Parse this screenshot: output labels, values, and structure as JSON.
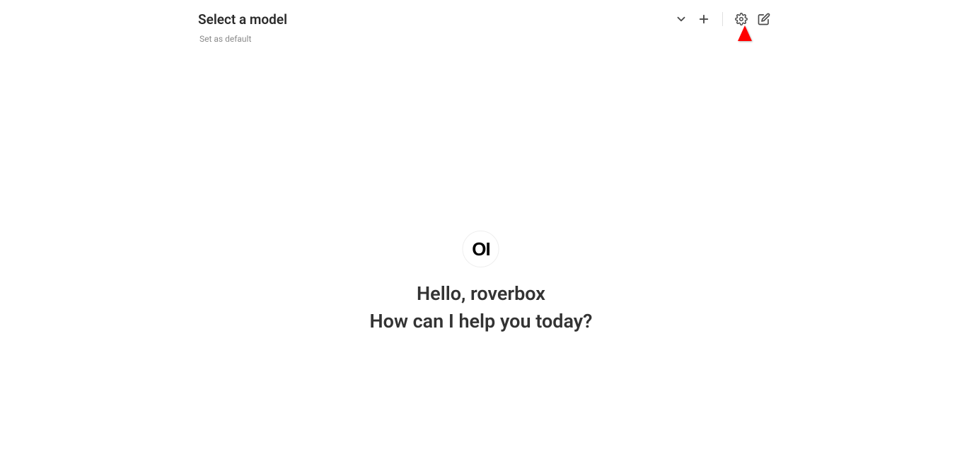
{
  "header": {
    "model_title": "Select a model",
    "model_subtitle": "Set as default"
  },
  "greeting": {
    "line1": "Hello, roverbox",
    "line2": "How can I help you today?"
  },
  "logo": {
    "text": "OI"
  }
}
